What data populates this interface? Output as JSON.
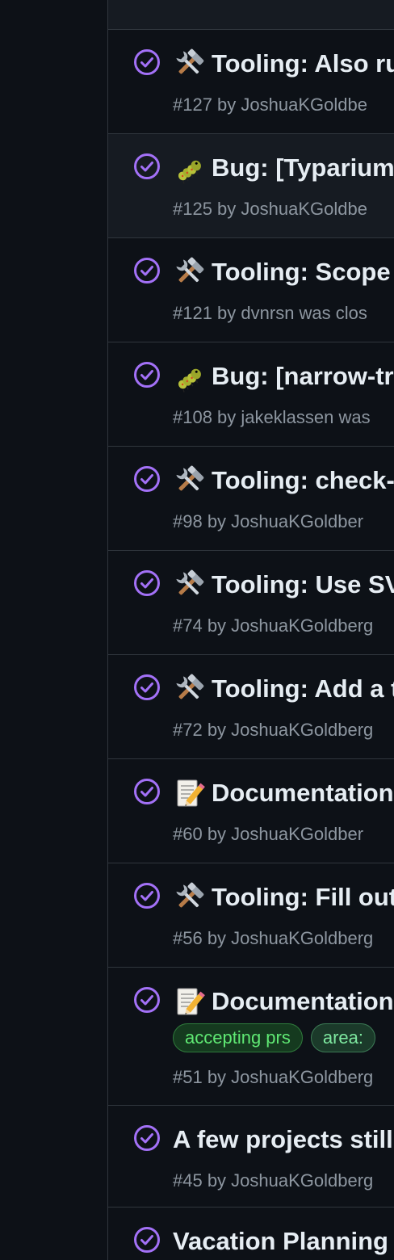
{
  "issues": [
    {
      "emoji": "tools",
      "title": "Tooling: Also ru",
      "meta": "#127 by JoshuaKGoldbe",
      "status": "closed-completed"
    },
    {
      "emoji": "bug",
      "title": "Bug: [Typarium",
      "meta": "#125 by JoshuaKGoldbe",
      "status": "closed-completed"
    },
    {
      "emoji": "tools",
      "title": "Tooling: Scope",
      "meta": "#121 by dvnrsn was clos",
      "status": "closed-completed"
    },
    {
      "emoji": "bug",
      "title": "Bug: [narrow-tr",
      "meta": "#108 by jakeklassen was",
      "status": "closed-completed"
    },
    {
      "emoji": "tools",
      "title": "Tooling: check-",
      "meta": "#98 by JoshuaKGoldber",
      "status": "closed-completed"
    },
    {
      "emoji": "tools",
      "title": "Tooling: Use SV",
      "meta": "#74 by JoshuaKGoldberg",
      "status": "closed-completed"
    },
    {
      "emoji": "tools",
      "title": "Tooling: Add a t",
      "meta": "#72 by JoshuaKGoldberg",
      "status": "closed-completed"
    },
    {
      "emoji": "memo",
      "title": "Documentation",
      "meta": "#60 by JoshuaKGoldber",
      "status": "closed-completed"
    },
    {
      "emoji": "tools",
      "title": "Tooling: Fill out",
      "meta": "#56 by JoshuaKGoldberg",
      "status": "closed-completed"
    },
    {
      "emoji": "memo",
      "title": "Documentation",
      "meta": "#51 by JoshuaKGoldberg",
      "status": "closed-completed",
      "labels": [
        {
          "text": "accepting prs",
          "color": "#5fe873",
          "bg": "#153a1f",
          "border": "#2f7a3c"
        },
        {
          "text": "area:",
          "color": "#7ee8a0",
          "bg": "#1b3a2a",
          "border": "#3c7a55"
        }
      ]
    },
    {
      "emoji": "",
      "title": "A few projects still",
      "meta": "#45 by JoshuaKGoldberg",
      "status": "closed-completed"
    },
    {
      "emoji": "",
      "title": "Vacation Planning",
      "meta": "",
      "status": "closed-completed"
    }
  ],
  "colors": {
    "completed": "#a371f7",
    "border": "#30363d",
    "muted": "#8d96a0",
    "text": "#e6edf3"
  }
}
